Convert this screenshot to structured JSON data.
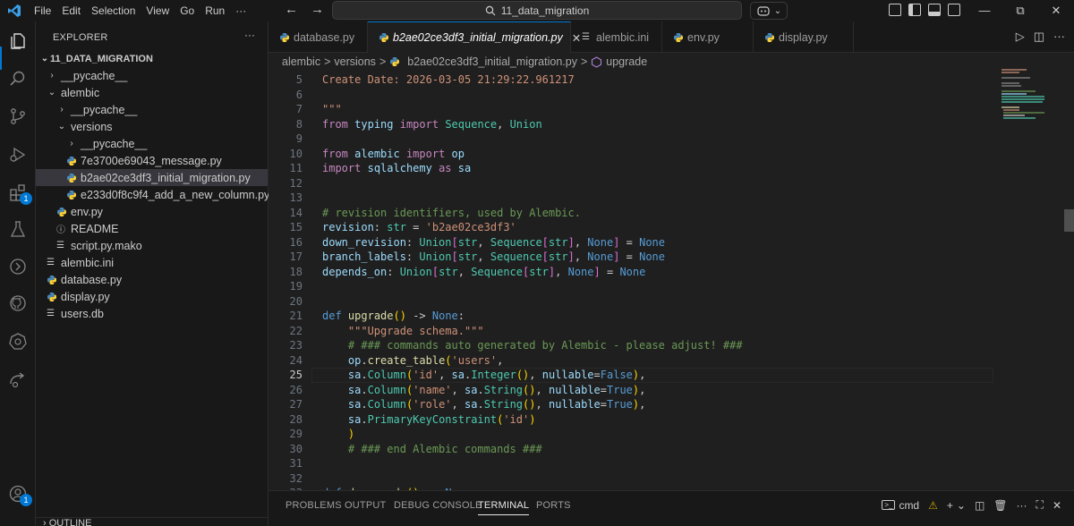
{
  "menu": [
    "File",
    "Edit",
    "Selection",
    "View",
    "Go",
    "Run",
    "···"
  ],
  "nav": {
    "back": "←",
    "forward": "→"
  },
  "command_center": {
    "text": "11_data_migration"
  },
  "window_controls": {
    "minimize": "—",
    "restore": "⧉",
    "close": "✕"
  },
  "sidebar": {
    "title": "EXPLORER",
    "more": "···",
    "root": "11_DATA_MIGRATION",
    "items": [
      {
        "label": "__pycache__",
        "depth": 0,
        "kind": "folder",
        "open": false
      },
      {
        "label": "alembic",
        "depth": 0,
        "kind": "folder",
        "open": true
      },
      {
        "label": "__pycache__",
        "depth": 1,
        "kind": "folder",
        "open": false
      },
      {
        "label": "versions",
        "depth": 1,
        "kind": "folder",
        "open": true
      },
      {
        "label": "__pycache__",
        "depth": 2,
        "kind": "folder",
        "open": false
      },
      {
        "label": "7e3700e69043_message.py",
        "depth": 2,
        "kind": "py"
      },
      {
        "label": "b2ae02ce3df3_initial_migration.py",
        "depth": 2,
        "kind": "py",
        "selected": true
      },
      {
        "label": "e233d0f8c9f4_add_a_new_column.py",
        "depth": 2,
        "kind": "py"
      },
      {
        "label": "env.py",
        "depth": 1,
        "kind": "py"
      },
      {
        "label": "README",
        "depth": 1,
        "kind": "info"
      },
      {
        "label": "script.py.mako",
        "depth": 1,
        "kind": "text"
      },
      {
        "label": "alembic.ini",
        "depth": 0,
        "kind": "text"
      },
      {
        "label": "database.py",
        "depth": 0,
        "kind": "py"
      },
      {
        "label": "display.py",
        "depth": 0,
        "kind": "py"
      },
      {
        "label": "users.db",
        "depth": 0,
        "kind": "text"
      }
    ],
    "outline": "OUTLINE"
  },
  "activity_badges": {
    "extensions": "1",
    "accounts": "1"
  },
  "tabs": [
    {
      "label": "database.py",
      "kind": "py"
    },
    {
      "label": "b2ae02ce3df3_initial_migration.py",
      "kind": "py",
      "active": true,
      "close": "✕"
    },
    {
      "label": "alembic.ini",
      "kind": "text"
    },
    {
      "label": "env.py",
      "kind": "py"
    },
    {
      "label": "display.py",
      "kind": "py"
    }
  ],
  "tab_actions": {
    "run": "▷",
    "split": "◫",
    "more": "···"
  },
  "breadcrumb": {
    "p1": "alembic",
    "sep": ">",
    "p2": "versions",
    "p3": "b2ae02ce3df3_initial_migration.py",
    "p4": "upgrade"
  },
  "code": {
    "current_line": 25,
    "lines": [
      {
        "n": "5",
        "text": "Create Date: 2026-03-05 21:29:22.961217"
      },
      {
        "n": "6",
        "text": ""
      },
      {
        "n": "7",
        "text": "\"\"\""
      },
      {
        "n": "8",
        "text": "from typing import Sequence, Union"
      },
      {
        "n": "9",
        "text": ""
      },
      {
        "n": "10",
        "text": "from alembic import op"
      },
      {
        "n": "11",
        "text": "import sqlalchemy as sa"
      },
      {
        "n": "12",
        "text": ""
      },
      {
        "n": "13",
        "text": ""
      },
      {
        "n": "14",
        "text": "# revision identifiers, used by Alembic."
      },
      {
        "n": "15",
        "text": "revision: str = 'b2ae02ce3df3'"
      },
      {
        "n": "16",
        "text": "down_revision: Union[str, Sequence[str], None] = None"
      },
      {
        "n": "17",
        "text": "branch_labels: Union[str, Sequence[str], None] = None"
      },
      {
        "n": "18",
        "text": "depends_on: Union[str, Sequence[str], None] = None"
      },
      {
        "n": "19",
        "text": ""
      },
      {
        "n": "20",
        "text": ""
      },
      {
        "n": "21",
        "text": "def upgrade() -> None:"
      },
      {
        "n": "22",
        "text": "    \"\"\"Upgrade schema.\"\"\""
      },
      {
        "n": "23",
        "text": "    # ### commands auto generated by Alembic - please adjust! ###"
      },
      {
        "n": "24",
        "text": "    op.create_table('users',"
      },
      {
        "n": "25",
        "text": "    sa.Column('id', sa.Integer(), nullable=False),"
      },
      {
        "n": "26",
        "text": "    sa.Column('name', sa.String(), nullable=True),"
      },
      {
        "n": "27",
        "text": "    sa.Column('role', sa.String(), nullable=True),"
      },
      {
        "n": "28",
        "text": "    sa.PrimaryKeyConstraint('id')"
      },
      {
        "n": "29",
        "text": "    )"
      },
      {
        "n": "30",
        "text": "    # ### end Alembic commands ###"
      },
      {
        "n": "31",
        "text": ""
      },
      {
        "n": "32",
        "text": ""
      },
      {
        "n": "33",
        "text": "def downgrade() -> None:"
      }
    ]
  },
  "panel": {
    "tabs": [
      "PROBLEMS",
      "OUTPUT",
      "DEBUG CONSOLE",
      "TERMINAL",
      "PORTS"
    ],
    "active": "TERMINAL",
    "terminal_name": "cmd"
  }
}
